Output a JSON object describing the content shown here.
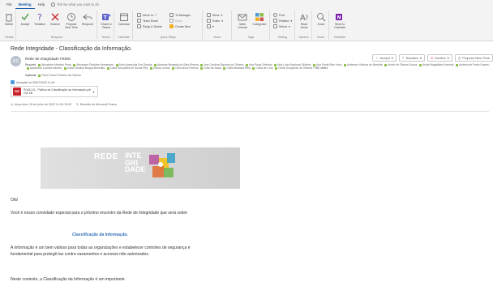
{
  "ribbon": {
    "tabs": [
      "File",
      "Meeting",
      "Help"
    ],
    "active_tab": "Meeting",
    "tell_me": "Tell me what you want to do",
    "groups": {
      "delete": {
        "label": "Delete",
        "buttons": [
          "Delete"
        ]
      },
      "respond": {
        "label": "Respond",
        "buttons": [
          "Accept",
          "Tentative",
          "Decline",
          "Propose New Time",
          "Respond"
        ]
      },
      "teams": {
        "label": "Teams",
        "buttons": [
          "Share to Teams"
        ]
      },
      "calendar": {
        "label": "Calendar",
        "buttons": [
          "Calendar"
        ]
      },
      "quick_steps": {
        "label": "Quick Steps",
        "items": [
          "Move to: ?",
          "Team Email",
          "Reply & Delete",
          "To Manager",
          "Done",
          "Create New"
        ]
      },
      "move": {
        "label": "Move",
        "items": [
          "Move",
          "Rules"
        ]
      },
      "tags": {
        "label": "Tags",
        "buttons": [
          "Mark Unread",
          "Categorize"
        ]
      },
      "editing": {
        "label": "Editing",
        "items": [
          "Find",
          "Related",
          "Select"
        ]
      },
      "speech": {
        "label": "Speech",
        "buttons": [
          "Read Aloud"
        ]
      },
      "zoom": {
        "label": "Zoom",
        "buttons": [
          "Zoom"
        ]
      },
      "onenote": {
        "label": "OneNote",
        "buttons": [
          "Send to OneNote"
        ]
      }
    }
  },
  "message": {
    "subject": "Rede Integridade - Classificação da Informação.",
    "sender": "Rede de Integridade  FEMG",
    "avatar_initials": "RD",
    "required_label": "Required",
    "required_names": [
      "Alexandre Mendes Pena",
      "Alexandre Palcides Hernandes",
      "Alice Aparecida Dos Santos",
      "Amanda Mergeda da Silva Pereira",
      "Ana Carolina Siqueira de Oliveira",
      "Ana Paula Zeferino",
      "Ana Lúcia Machado Silveira",
      "Ana Paula Reis Lima",
      "Anderson Vinicius de Almeida",
      "André de Oliveira Souza",
      "André Magalhães Arrenrio",
      "Andreia de Paula Suares",
      "Aparecido Lucinéa Sandro",
      "Carla Carolina Burgos Benedito",
      "Carla Gonçalves de Souza Pita",
      "Carlos Lemos",
      "Célio Alves Pereira",
      "Celso de Assis",
      "Cintia Barbosa Reis",
      "Cintia de Cruz",
      "Cintia Gonçalves de Oliveira"
    ],
    "required_more": "+ 962 others",
    "optional_label": "Optional",
    "optional_name": "Paulo Sonso Pinheiro de Oliveira",
    "accepted": "Accepted on 25/07/2022 11:49",
    "attachment_name": "POAD-01 - Política de Classificação da Informação.pdf",
    "attachment_size": "231 KB",
    "attachment_badge": "PDF",
    "datetime": "terça-feira, 26 de julho de 2022 14:00-15:00",
    "location": "Reunião do Microsoft Teams",
    "actions": [
      "Accept",
      "Tentative",
      "Decline",
      "Propose New Time"
    ]
  },
  "body": {
    "banner_word1": "REDE",
    "banner_word2_lines": [
      "INTE",
      "GRI",
      "DADE"
    ],
    "greeting": "Olá!",
    "p1": "Você é nosso convidado especial para o próximo encontro da Rede de Integridade que será sobre",
    "highlight": "Classificação da Informação.",
    "p2": "A informação é um bem valioso para todas as organizações e estabelecer controles de segurança é fundamental para protegê-las contra vazamentos e acessos não autorizados.",
    "p3": "Neste contexto, a Classificação da Informação é um importante"
  },
  "colors": {
    "accent": "#1b5fa8",
    "accept_green": "#3c9b3c",
    "decline_red": "#c8232b",
    "tentative_purple": "#7d4fb0",
    "teams_purple": "#5b5fc7"
  }
}
